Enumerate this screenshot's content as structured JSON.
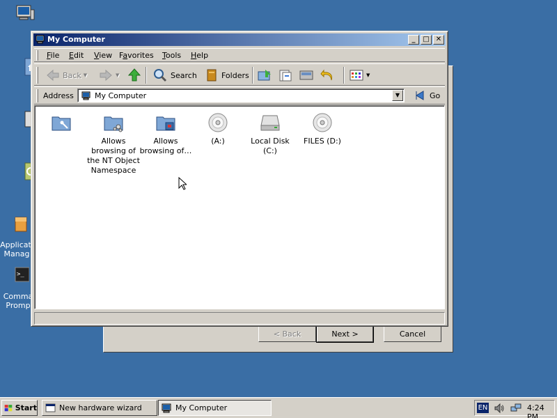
{
  "desktop": {
    "icons": [
      {
        "label": "",
        "icon": "computer-icon"
      },
      {
        "label": "",
        "icon": "home-folder-icon"
      },
      {
        "label": "",
        "icon": "network-icon"
      },
      {
        "label": "",
        "icon": "recycle-bin-icon"
      },
      {
        "label": "Applicati\nManag",
        "icon": "app-manager-icon"
      },
      {
        "label": "Comma\nPromp",
        "icon": "command-prompt-icon"
      }
    ]
  },
  "wizard": {
    "back_label": "< Back",
    "next_label": "Next >",
    "cancel_label": "Cancel"
  },
  "window": {
    "title": "My Computer",
    "title_buttons": {
      "minimize": "_",
      "maximize": "□",
      "close": "✕"
    }
  },
  "menu": {
    "items": [
      {
        "label": "File",
        "accel": "F",
        "rest": "ile"
      },
      {
        "label": "Edit",
        "accel": "E",
        "rest": "dit"
      },
      {
        "label": "View",
        "accel": "V",
        "rest": "iew"
      },
      {
        "label": "Favorites",
        "accel": "F",
        "rest": "avorites",
        "prefix": "F"
      },
      {
        "label": "Tools",
        "accel": "T",
        "rest": "ools"
      },
      {
        "label": "Help",
        "accel": "H",
        "rest": "elp"
      }
    ]
  },
  "toolbar": {
    "back_label": "Back",
    "search_label": "Search",
    "folders_label": "Folders"
  },
  "address": {
    "label": "Address",
    "value": "My Computer",
    "go_label": "Go"
  },
  "items": [
    {
      "label": "",
      "icon": "control-panel-folder-icon"
    },
    {
      "label": "Allows browsing of the NT Object Namespace",
      "icon": "nt-object-folder-icon"
    },
    {
      "label": "Allows browsing of…",
      "icon": "registry-folder-icon"
    },
    {
      "label": "(A:)",
      "icon": "floppy-drive-icon"
    },
    {
      "label": "Local Disk (C:)",
      "icon": "hard-disk-icon"
    },
    {
      "label": "FILES (D:)",
      "icon": "cd-drive-icon"
    }
  ],
  "taskbar": {
    "start_label": "Start",
    "tasks": [
      {
        "label": "New hardware wizard",
        "active": false
      },
      {
        "label": "My Computer",
        "active": true
      }
    ],
    "lang": "EN",
    "clock": "4:24 PM"
  },
  "colors": {
    "desktop": "#3a6ea5",
    "title_start": "#0a246a",
    "title_end": "#a6caf0",
    "face": "#d4d0c8"
  }
}
